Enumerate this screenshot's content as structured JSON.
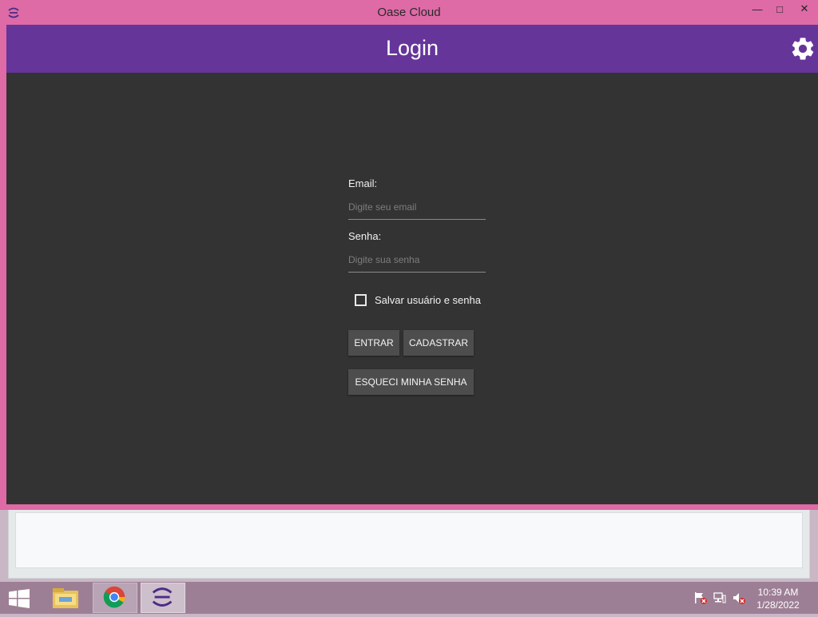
{
  "window": {
    "title": "Oase Cloud",
    "controls": {
      "minimize": "—",
      "maximize": "□",
      "close": "✕"
    }
  },
  "header": {
    "title": "Login",
    "settings_icon": "gear-icon"
  },
  "form": {
    "email": {
      "label": "Email:",
      "placeholder": "Digite seu email",
      "value": ""
    },
    "senha": {
      "label": "Senha:",
      "placeholder": "Digite sua senha",
      "value": ""
    },
    "remember": {
      "label": "Salvar usuário e senha",
      "checked": false
    },
    "buttons": {
      "entrar": "ENTRAR",
      "cadastrar": "CADASTRAR",
      "esqueci": "ESQUECI MINHA SENHA"
    }
  },
  "taskbar": {
    "items": [
      "windows-start-icon",
      "file-explorer-icon",
      "chrome-icon",
      "oase-cloud-icon"
    ],
    "tray": [
      "action-center-flag-icon",
      "network-icon",
      "volume-muted-icon"
    ],
    "clock": {
      "time": "10:39 AM",
      "date": "1/28/2022"
    }
  },
  "colors": {
    "header": "#66359a",
    "client_bg": "#333333",
    "window_frame": "#de6aa6",
    "button_bg": "#4d4d4d"
  }
}
